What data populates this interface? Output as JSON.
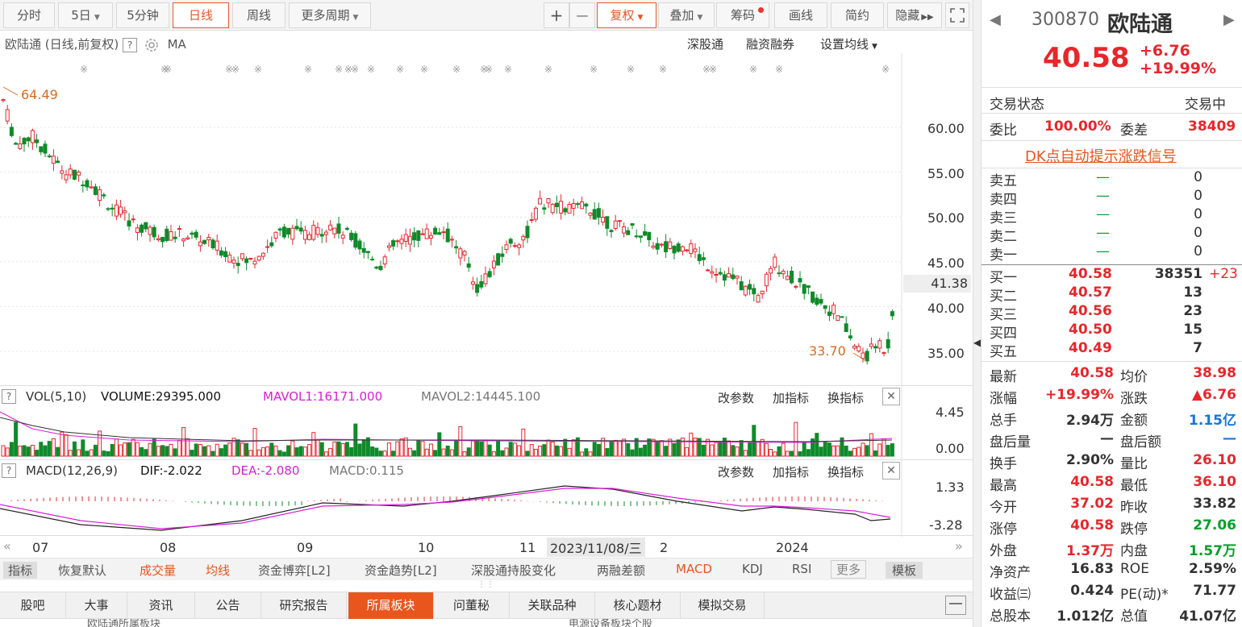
{
  "toolbar": {
    "items": [
      {
        "label": "分时"
      },
      {
        "label": "5日",
        "dropdown": true
      },
      {
        "label": "5分钟"
      },
      {
        "label": "日线",
        "active": true
      },
      {
        "label": "周线"
      },
      {
        "label": "更多周期",
        "dropdown": true
      }
    ],
    "zoom_in": "+",
    "zoom_out": "—",
    "fuquan": "复权",
    "overlay": "叠加",
    "chips": "筹码",
    "draw": "画线",
    "simple": "简约",
    "hide": "隐藏"
  },
  "chart": {
    "title": "欧陆通 (日线,前复权)",
    "ma_label": "MA",
    "links": [
      "深股通",
      "融资融券",
      "设置均线"
    ],
    "y_labels": [
      "60.00",
      "55.00",
      "50.00",
      "45.00",
      "40.00",
      "35.00"
    ],
    "current_price_tag": "41.38",
    "high_marker": "64.49",
    "low_marker": "33.70",
    "x_labels": [
      "07",
      "08",
      "09",
      "10",
      "11",
      "2024"
    ],
    "crosshair_date": "2023/11/08/三",
    "crosshair_suffix": "2"
  },
  "volume": {
    "title": "VOL(5,10)",
    "volume": "VOLUME:29395.000",
    "mavol1": "MAVOL1:16171.000",
    "mavol2": "MAVOL2:14445.100",
    "y_top": "4.45",
    "y_bottom": "0.00"
  },
  "macd": {
    "title": "MACD(12,26,9)",
    "dif": "DIF:-2.022",
    "dea": "DEA:-2.080",
    "macd": "MACD:0.115",
    "y_top": "1.33",
    "y_bottom": "-3.28"
  },
  "panel_buttons": {
    "params": "改参数",
    "add": "加指标",
    "switch": "换指标"
  },
  "bottom_nav": {
    "items": [
      "指标",
      "恢复默认",
      "成交量",
      "均线",
      "资金博弈[L2]",
      "资金趋势[L2]",
      "深股通持股变化",
      "两融差额",
      "MACD",
      "KDJ",
      "RSI",
      "更多"
    ],
    "template": "模板"
  },
  "tabs": [
    {
      "label": "股吧"
    },
    {
      "label": "大事"
    },
    {
      "label": "资讯"
    },
    {
      "label": "公告"
    },
    {
      "label": "研究报告"
    },
    {
      "label": "所属板块",
      "active": true
    },
    {
      "label": "问董秘"
    },
    {
      "label": "关联品种"
    },
    {
      "label": "核心题材"
    },
    {
      "label": "模拟交易"
    }
  ],
  "bottom_cut": {
    "left": "欧陆通所属板块",
    "right": "电源设备板块个股"
  },
  "stock": {
    "code": "300870",
    "name": "欧陆通",
    "price": "40.58",
    "change": "+6.76",
    "change_pct": "+19.99%",
    "trade_status_label": "交易状态",
    "trade_status": "交易中",
    "weibi_label": "委比",
    "weibi": "100.00%",
    "weicha_label": "委差",
    "weicha": "38409",
    "signal_link": "DK点自动提示涨跌信号",
    "asks": [
      {
        "label": "卖五",
        "price": "—",
        "vol": "0"
      },
      {
        "label": "卖四",
        "price": "—",
        "vol": "0"
      },
      {
        "label": "卖三",
        "price": "—",
        "vol": "0"
      },
      {
        "label": "卖二",
        "price": "—",
        "vol": "0"
      },
      {
        "label": "卖一",
        "price": "—",
        "vol": "0"
      }
    ],
    "bids": [
      {
        "label": "买一",
        "price": "40.58",
        "vol": "38351",
        "delta": "+23"
      },
      {
        "label": "买二",
        "price": "40.57",
        "vol": "13"
      },
      {
        "label": "买三",
        "price": "40.56",
        "vol": "23"
      },
      {
        "label": "买四",
        "price": "40.50",
        "vol": "15"
      },
      {
        "label": "买五",
        "price": "40.49",
        "vol": "7"
      }
    ],
    "stats": [
      {
        "l1": "最新",
        "v1": "40.58",
        "c1": "red",
        "l2": "均价",
        "v2": "38.98",
        "c2": "red"
      },
      {
        "l1": "涨幅",
        "v1": "+19.99%",
        "c1": "red",
        "l2": "涨跌",
        "v2": "▲6.76",
        "c2": "red"
      },
      {
        "l1": "总手",
        "v1": "2.94万",
        "c1": "dark",
        "l2": "金额",
        "v2": "1.15亿",
        "c2": "blue"
      },
      {
        "l1": "盘后量",
        "v1": "—",
        "c1": "dark",
        "l2": "盘后额",
        "v2": "—",
        "c2": "blue"
      },
      {
        "l1": "换手",
        "v1": "2.90%",
        "c1": "dark",
        "l2": "量比",
        "v2": "26.10",
        "c2": "red"
      },
      {
        "l1": "最高",
        "v1": "40.58",
        "c1": "red",
        "l2": "最低",
        "v2": "36.10",
        "c2": "red"
      },
      {
        "l1": "今开",
        "v1": "37.02",
        "c1": "red",
        "l2": "昨收",
        "v2": "33.82",
        "c2": "dark"
      },
      {
        "l1": "涨停",
        "v1": "40.58",
        "c1": "red",
        "l2": "跌停",
        "v2": "27.06",
        "c2": "green"
      },
      {
        "l1": "外盘",
        "v1": "1.37万",
        "c1": "red",
        "l2": "内盘",
        "v2": "1.57万",
        "c2": "green"
      },
      {
        "l1": "净资产",
        "v1": "16.83",
        "c1": "dark",
        "l2": "ROE",
        "v2": "2.59%",
        "c2": "dark"
      },
      {
        "l1": "收益㈢",
        "v1": "0.424",
        "c1": "dark",
        "l2": "PE(动)*",
        "v2": "71.77",
        "c2": "dark"
      },
      {
        "l1": "总股本",
        "v1": "1.012亿",
        "c1": "dark",
        "l2": "总值",
        "v2": "41.07亿",
        "c2": "dark"
      }
    ]
  },
  "colors": {
    "up": "#e8262b",
    "down": "#0f8a2a",
    "accent": "#e8561e",
    "dea": "#d81ed8",
    "dif": "#222222"
  },
  "chart_data": {
    "type": "candlestick",
    "x_axis_labels": [
      "07",
      "08",
      "09",
      "10",
      "11",
      "2024"
    ],
    "y_ticks": [
      60,
      55,
      50,
      45,
      40,
      35
    ],
    "high": 64.49,
    "low": 33.7,
    "last": 40.58,
    "price_tag": 41.38
  }
}
